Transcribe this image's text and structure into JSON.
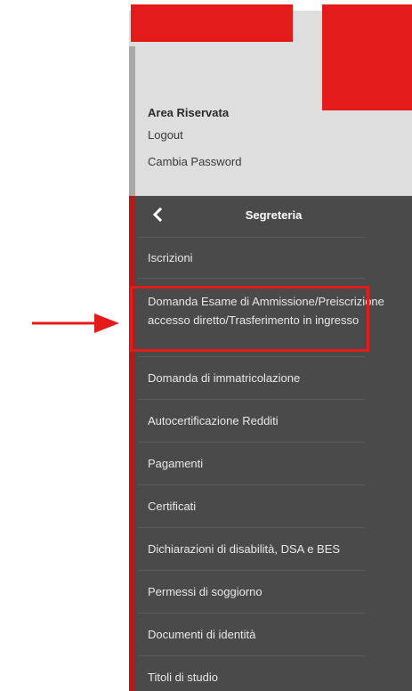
{
  "user_area": {
    "title": "Area Riservata",
    "logout": "Logout",
    "change_password": "Cambia Password"
  },
  "menu": {
    "title": "Segreteria",
    "items": [
      {
        "label": "Iscrizioni"
      },
      {
        "label": "Domanda Esame di Ammissione/Preiscrizione accesso diretto/Trasferimento in ingresso"
      },
      {
        "label": "Domanda di immatricolazione"
      },
      {
        "label": "Autocertificazione Redditi"
      },
      {
        "label": "Pagamenti"
      },
      {
        "label": "Certificati"
      },
      {
        "label": "Dichiarazioni di disabilità, DSA e BES"
      },
      {
        "label": "Permessi di soggiorno"
      },
      {
        "label": "Documenti di identità"
      },
      {
        "label": "Titoli di studio"
      }
    ]
  },
  "colors": {
    "accent": "#e31b1b",
    "menu_bg": "#4a4a4a",
    "top_bg": "#dedede"
  },
  "icons": {
    "back": "chevron-left-icon",
    "pointer": "arrow-right-icon"
  }
}
